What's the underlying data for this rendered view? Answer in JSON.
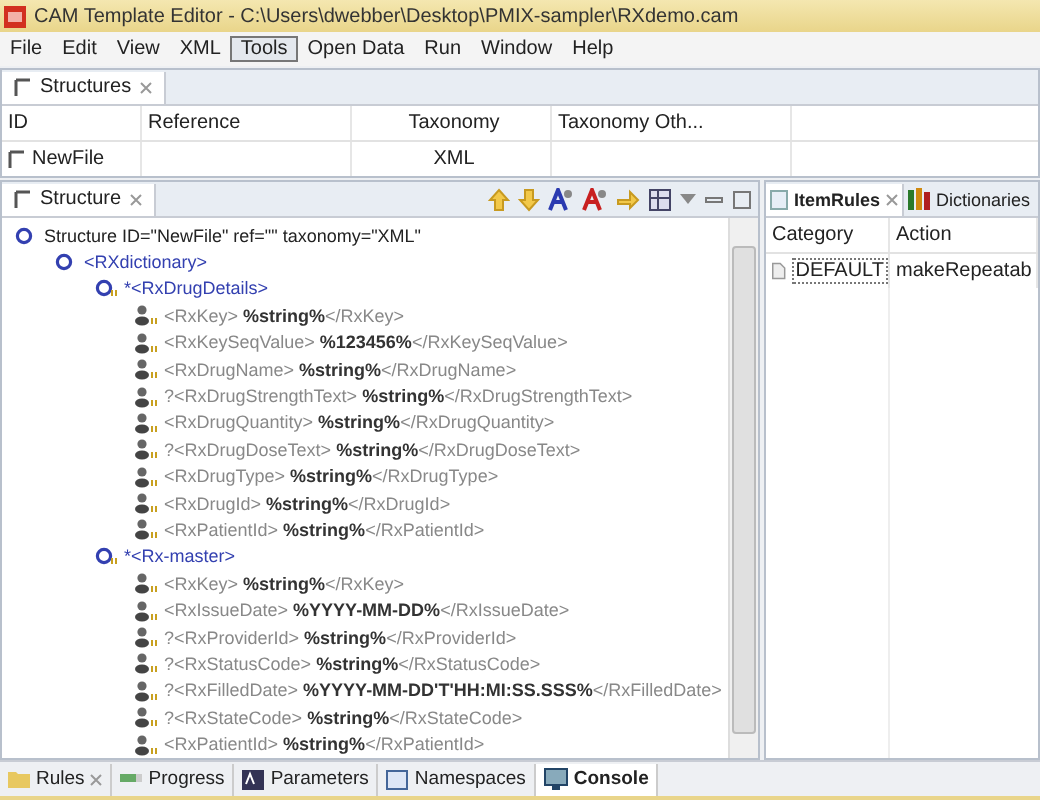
{
  "window": {
    "title": "CAM Template Editor - C:\\Users\\dwebber\\Desktop\\PMIX-sampler\\RXdemo.cam"
  },
  "menu": [
    {
      "label": "File",
      "selected": false
    },
    {
      "label": "Edit",
      "selected": false
    },
    {
      "label": "View",
      "selected": false
    },
    {
      "label": "XML",
      "selected": false
    },
    {
      "label": "Tools",
      "selected": true
    },
    {
      "label": "Open Data",
      "selected": false
    },
    {
      "label": "Run",
      "selected": false
    },
    {
      "label": "Window",
      "selected": false
    },
    {
      "label": "Help",
      "selected": false
    }
  ],
  "structures": {
    "tab": "Structures",
    "columns": [
      "ID",
      "Reference",
      "Taxonomy",
      "Taxonomy Oth..."
    ],
    "rows": [
      [
        "NewFile",
        "",
        "XML",
        ""
      ]
    ]
  },
  "structure": {
    "tab": "Structure",
    "tree": [
      {
        "kind": "root",
        "label": "Structure ID=\"NewFile\" ref=\"\" taxonomy=\"XML\"",
        "children": [
          {
            "kind": "group",
            "label": "<RXdictionary>",
            "children": [
              {
                "kind": "group",
                "marker": "*",
                "label": "<RxDrugDetails>",
                "children": [
                  {
                    "kind": "leaf",
                    "open": "<RxKey>",
                    "value": "%string%",
                    "close": "</RxKey>"
                  },
                  {
                    "kind": "leaf",
                    "open": "<RxKeySeqValue>",
                    "value": "%123456%",
                    "close": "</RxKeySeqValue>"
                  },
                  {
                    "kind": "leaf",
                    "open": "<RxDrugName>",
                    "value": "%string%",
                    "close": "</RxDrugName>"
                  },
                  {
                    "kind": "leaf",
                    "marker": "?",
                    "open": "<RxDrugStrengthText>",
                    "value": "%string%",
                    "close": "</RxDrugStrengthText>"
                  },
                  {
                    "kind": "leaf",
                    "open": "<RxDrugQuantity>",
                    "value": "%string%",
                    "close": "</RxDrugQuantity>"
                  },
                  {
                    "kind": "leaf",
                    "marker": "?",
                    "open": "<RxDrugDoseText>",
                    "value": "%string%",
                    "close": "</RxDrugDoseText>"
                  },
                  {
                    "kind": "leaf",
                    "open": "<RxDrugType>",
                    "value": "%string%",
                    "close": "</RxDrugType>"
                  },
                  {
                    "kind": "leaf",
                    "open": "<RxDrugId>",
                    "value": "%string%",
                    "close": "</RxDrugId>"
                  },
                  {
                    "kind": "leaf",
                    "open": "<RxPatientId>",
                    "value": "%string%",
                    "close": "</RxPatientId>"
                  }
                ]
              },
              {
                "kind": "group",
                "marker": "*",
                "label": "<Rx-master>",
                "children": [
                  {
                    "kind": "leaf",
                    "open": "<RxKey>",
                    "value": "%string%",
                    "close": "</RxKey>"
                  },
                  {
                    "kind": "leaf",
                    "open": "<RxIssueDate>",
                    "value": "%YYYY-MM-DD%",
                    "close": "</RxIssueDate>"
                  },
                  {
                    "kind": "leaf",
                    "marker": "?",
                    "open": "<RxProviderId>",
                    "value": "%string%",
                    "close": "</RxProviderId>"
                  },
                  {
                    "kind": "leaf",
                    "marker": "?",
                    "open": "<RxStatusCode>",
                    "value": "%string%",
                    "close": "</RxStatusCode>"
                  },
                  {
                    "kind": "leaf",
                    "marker": "?",
                    "open": "<RxFilledDate>",
                    "value": "%YYYY-MM-DD'T'HH:MI:SS.SSS%",
                    "close": "</RxFilledDate>"
                  },
                  {
                    "kind": "leaf",
                    "marker": "?",
                    "open": "<RxStateCode>",
                    "value": "%string%",
                    "close": "</RxStateCode>"
                  },
                  {
                    "kind": "leaf",
                    "open": "<RxPatientId>",
                    "value": "%string%",
                    "close": "</RxPatientId>"
                  }
                ]
              }
            ]
          }
        ]
      }
    ]
  },
  "right_panel": {
    "tabs": [
      {
        "label": "ItemRules",
        "selected": true
      },
      {
        "label": "Dictionaries",
        "selected": false
      }
    ],
    "columns": [
      "Category",
      "Action"
    ],
    "rows": [
      [
        "DEFAULT",
        "makeRepeatab"
      ]
    ]
  },
  "bottom_tabs": [
    {
      "label": "Rules",
      "selected": false
    },
    {
      "label": "Progress",
      "selected": false
    },
    {
      "label": "Parameters",
      "selected": false
    },
    {
      "label": "Namespaces",
      "selected": false
    },
    {
      "label": "Console",
      "selected": true
    }
  ]
}
